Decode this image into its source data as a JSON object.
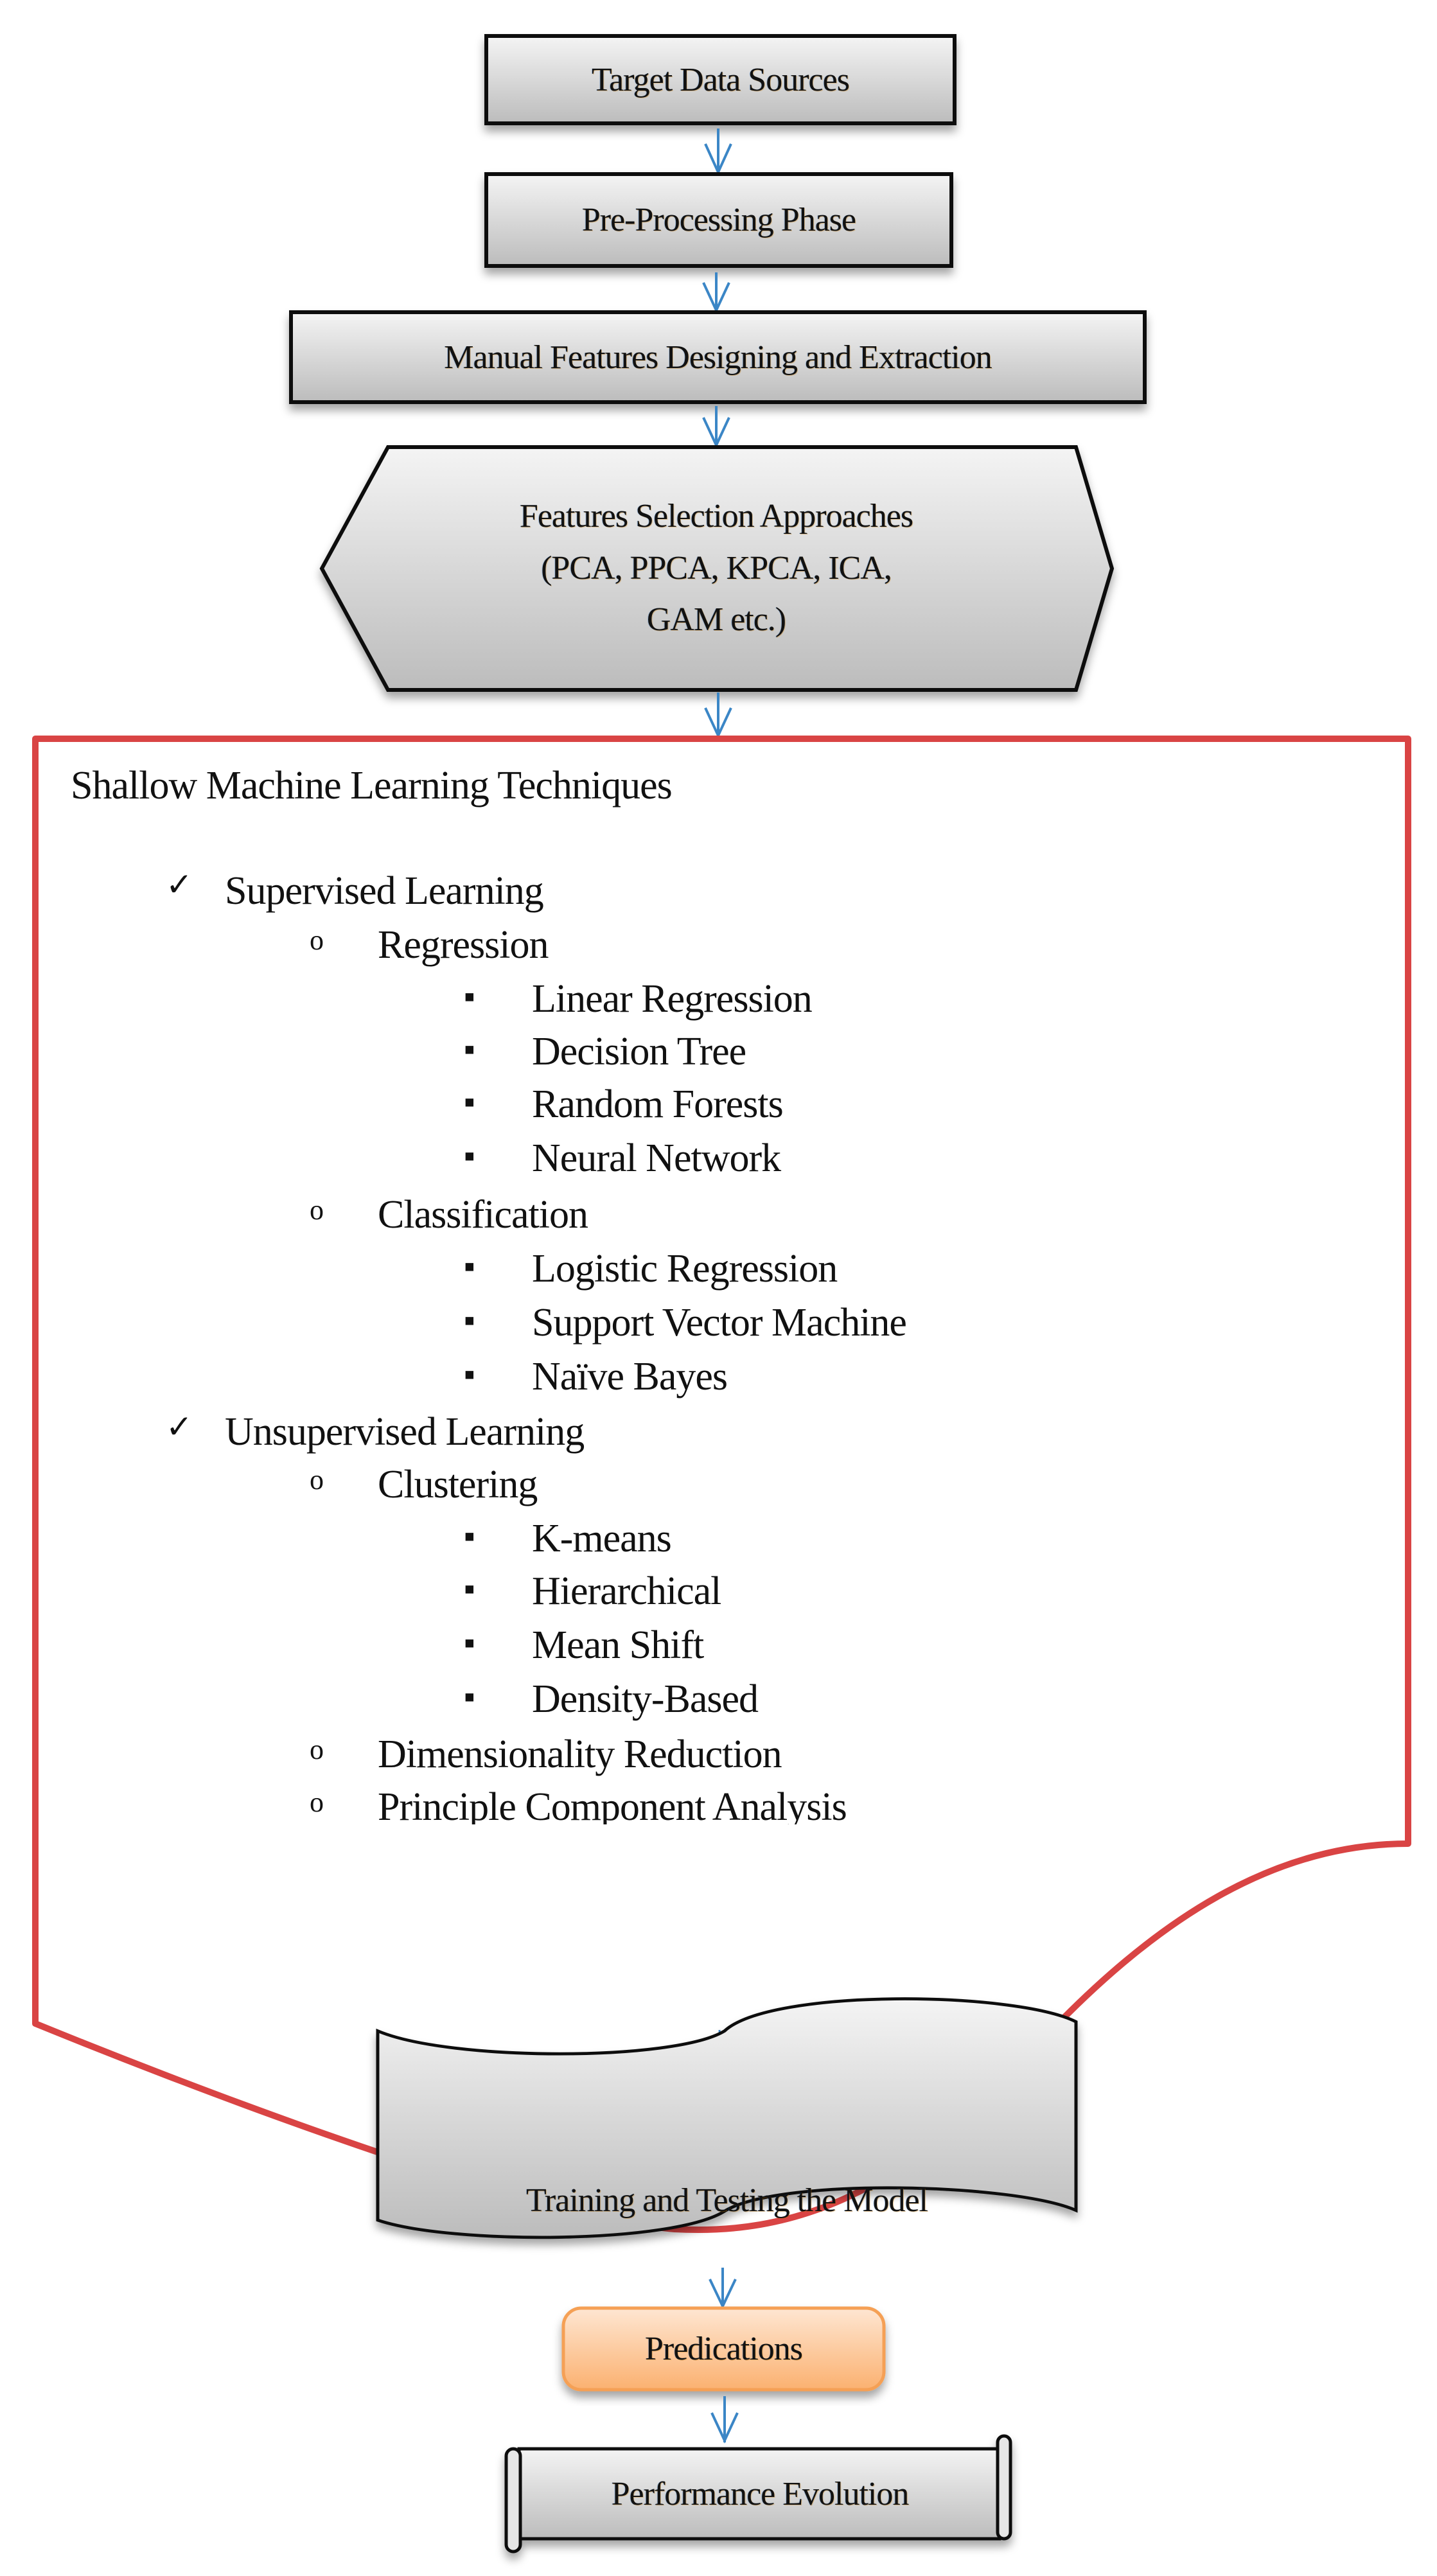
{
  "diagram": {
    "type": "flowchart",
    "colors": {
      "box_fill_top": "#f2f2f2",
      "box_fill_bottom": "#bdbdbd",
      "box_border": "#111111",
      "arrow": "#3b86c6",
      "container_border": "#d94444",
      "highlight_fill_top": "#fde3cc",
      "highlight_fill_bottom": "#fbb57a",
      "highlight_border": "#f5a055"
    },
    "nodes": {
      "target": {
        "label": "Target Data Sources"
      },
      "preprocessing": {
        "label": "Pre-Processing  Phase"
      },
      "manual": {
        "label": "Manual Features Designing and Extraction"
      },
      "selection": {
        "line1": "Features Selection  Approaches",
        "line2": "(PCA,  PPCA,  KPCA,  ICA,",
        "line3": "GAM etc.)"
      },
      "training": {
        "label": "Training and Testing the Model"
      },
      "predications": {
        "label": "Predications"
      },
      "performance": {
        "label": "Performance Evolution"
      }
    },
    "techniques": {
      "title": "Shallow Machine Learning Techniques",
      "check_symbol": "✓",
      "circle_symbol": "o",
      "square_symbol": "▪",
      "groups": [
        {
          "label": "Supervised Learning",
          "subgroups": [
            {
              "label": "Regression",
              "items": [
                "Linear Regression",
                "Decision Tree",
                "Random Forests",
                "Neural Network"
              ]
            },
            {
              "label": "Classification",
              "items": [
                "Logistic Regression",
                "Support Vector Machine",
                "Naïve Bayes"
              ]
            }
          ]
        },
        {
          "label": "Unsupervised Learning",
          "subgroups": [
            {
              "label": "Clustering",
              "items": [
                "K-means",
                "Hierarchical",
                "Mean Shift",
                "Density-Based"
              ]
            },
            {
              "label": "Dimensionality Reduction",
              "items": []
            },
            {
              "label": "Principle Component Analysis",
              "items": []
            }
          ]
        }
      ]
    }
  }
}
